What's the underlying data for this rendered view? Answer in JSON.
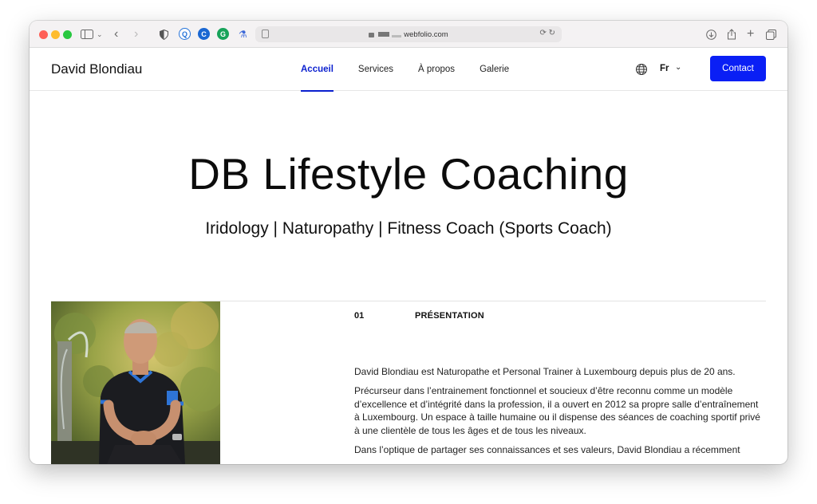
{
  "browser": {
    "url": "webfolio.com",
    "url_prefix": "•"
  },
  "site": {
    "brand": "David Blondiau",
    "nav": [
      {
        "label": "Accueil",
        "active": true
      },
      {
        "label": "Services",
        "active": false
      },
      {
        "label": "À propos",
        "active": false
      },
      {
        "label": "Galerie",
        "active": false
      }
    ],
    "language": "Fr",
    "contact_label": "Contact",
    "accent_color": "#0a1ff5"
  },
  "hero": {
    "title": "DB Lifestyle Coaching",
    "subtitle": "Iridology | Naturopathy | Fitness Coach (Sports Coach)"
  },
  "section": {
    "number": "01",
    "title": "PRÉSENTATION",
    "paragraphs": [
      "David Blondiau est Naturopathe et Personal Trainer à Luxembourg depuis plus de 20 ans.",
      "Précurseur dans l’entrainement fonctionnel et soucieux d’être reconnu comme un modèle d’excellence et d’intégrité dans la profession, il a ouvert en 2012 sa propre salle d’entraînement à Luxembourg. Un espace à taille humaine ou il dispense des séances de coaching sportif privé à une clientèle de tous les âges et de tous les niveaux.",
      "Dans l’optique de partager ses connaissances et ses valeurs, David Blondiau a récemment"
    ]
  }
}
